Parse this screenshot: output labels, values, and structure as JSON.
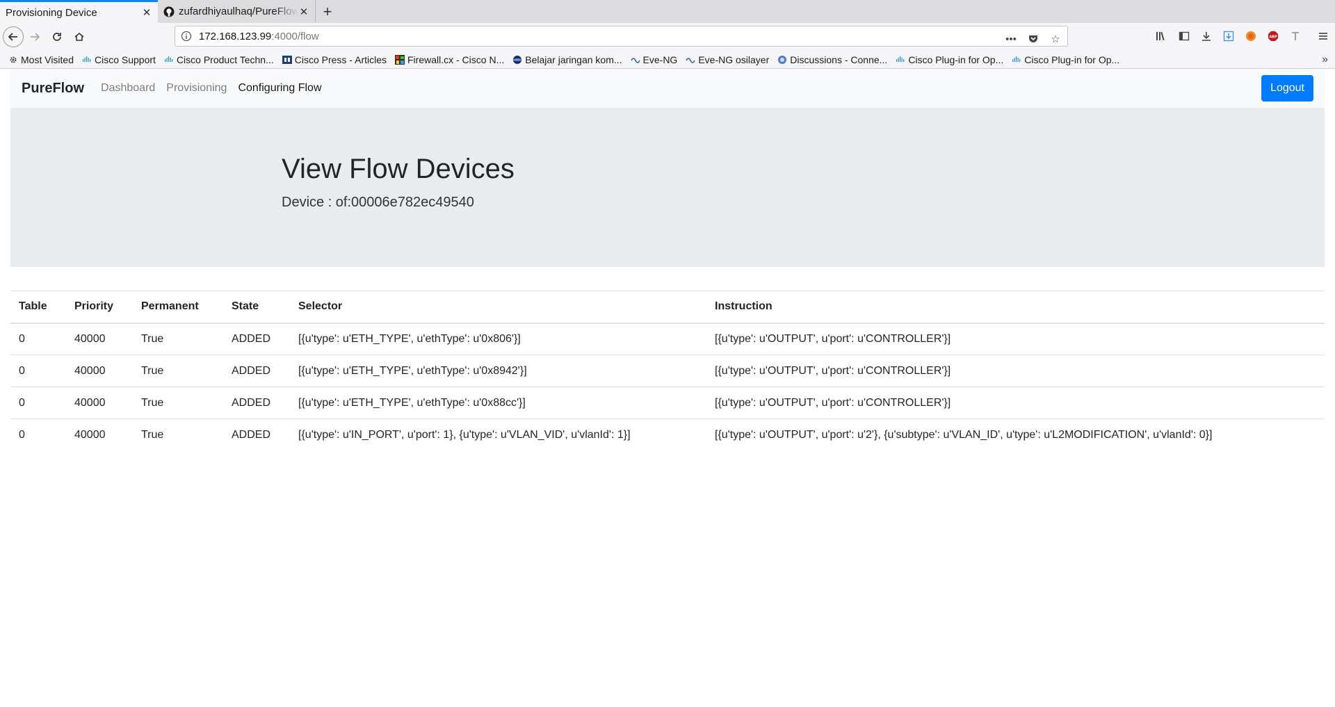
{
  "browser": {
    "tabs": [
      {
        "title": "Provisioning Device",
        "active": true
      },
      {
        "title": "zufardhiyaulhaq/PureFlow",
        "active": false
      }
    ],
    "url_host": "172.168.123.99",
    "url_path": ":4000/flow",
    "bookmarks": [
      "Most Visited",
      "Cisco Support",
      "Cisco Product Techn...",
      "Cisco Press - Articles",
      "Firewall.cx - Cisco N...",
      "Belajar jaringan kom...",
      "Eve-NG",
      "Eve-NG osilayer",
      "Discussions - Conne...",
      "Cisco Plug-in for Op...",
      "Cisco Plug-in for Op..."
    ],
    "icons": [
      "back-icon",
      "forward-icon",
      "reload-icon",
      "home-icon",
      "info-icon",
      "more-icon",
      "pocket-icon",
      "star-icon",
      "library-icon",
      "sidebar-icon",
      "download-icon",
      "save-icon",
      "firefox-account-icon",
      "adblock-icon",
      "text-icon",
      "menu-icon"
    ]
  },
  "app": {
    "brand": "PureFlow",
    "nav": {
      "dashboard": "Dashboard",
      "provisioning": "Provisioning",
      "configuring": "Configuring Flow"
    },
    "logout": "Logout",
    "heading": "View Flow Devices",
    "device": "Device : of:00006e782ec49540",
    "colors": {
      "primary": "#007bff",
      "jumbotron": "#e9ecef",
      "navbar": "#f8f9fa"
    }
  },
  "table": {
    "headers": [
      "Table",
      "Priority",
      "Permanent",
      "State",
      "Selector",
      "Instruction"
    ],
    "rows": [
      [
        "0",
        "40000",
        "True",
        "ADDED",
        "[{u'type': u'ETH_TYPE', u'ethType': u'0x806'}]",
        "[{u'type': u'OUTPUT', u'port': u'CONTROLLER'}]"
      ],
      [
        "0",
        "40000",
        "True",
        "ADDED",
        "[{u'type': u'ETH_TYPE', u'ethType': u'0x8942'}]",
        "[{u'type': u'OUTPUT', u'port': u'CONTROLLER'}]"
      ],
      [
        "0",
        "40000",
        "True",
        "ADDED",
        "[{u'type': u'ETH_TYPE', u'ethType': u'0x88cc'}]",
        "[{u'type': u'OUTPUT', u'port': u'CONTROLLER'}]"
      ],
      [
        "0",
        "40000",
        "True",
        "ADDED",
        "[{u'type': u'IN_PORT', u'port': 1}, {u'type': u'VLAN_VID', u'vlanId': 1}]",
        "[{u'type': u'OUTPUT', u'port': u'2'}, {u'subtype': u'VLAN_ID', u'type': u'L2MODIFICATION', u'vlanId': 0}]"
      ]
    ]
  }
}
